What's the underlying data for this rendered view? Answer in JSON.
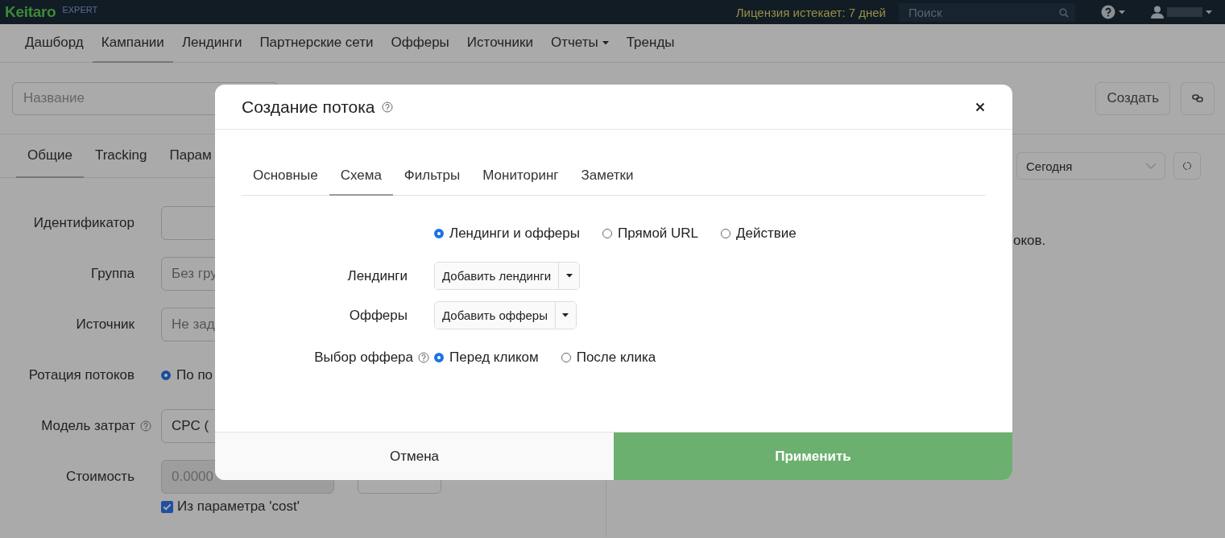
{
  "topbar": {
    "logo": "Keitaro",
    "edition": "EXPERT",
    "license": "Лицензия истекает: 7 дней",
    "search": {
      "placeholder": "Поиск"
    }
  },
  "nav": [
    {
      "label": "Дашборд",
      "selected": false,
      "dropdown": false
    },
    {
      "label": "Кампании",
      "selected": true,
      "dropdown": false
    },
    {
      "label": "Лендинги",
      "selected": false,
      "dropdown": false
    },
    {
      "label": "Партнерские сети",
      "selected": false,
      "dropdown": false
    },
    {
      "label": "Офферы",
      "selected": false,
      "dropdown": false
    },
    {
      "label": "Источники",
      "selected": false,
      "dropdown": false
    },
    {
      "label": "Отчеты",
      "selected": false,
      "dropdown": true
    },
    {
      "label": "Тренды",
      "selected": false,
      "dropdown": false
    }
  ],
  "toolbar": {
    "name_field": {
      "placeholder": "Название"
    },
    "create_button": "Создать"
  },
  "campaign_tabs": [
    {
      "label": "Общие",
      "selected": true
    },
    {
      "label": "Tracking",
      "selected": false
    },
    {
      "label": "Парам",
      "selected": false
    }
  ],
  "form": [
    {
      "label": "Идентификатор",
      "kind": "text"
    },
    {
      "label": "Группа",
      "kind": "text",
      "placeholder": "Без гру"
    },
    {
      "label": "Источник",
      "kind": "text",
      "placeholder": "Не зад"
    },
    {
      "label": "Ротация потоков",
      "kind": "radio",
      "option": "По по",
      "selected": true
    },
    {
      "label": "Модель затрат",
      "kind": "select",
      "help": true,
      "value": "CPC ("
    },
    {
      "label": "Стоимость",
      "kind": "cost",
      "value": "0.0000",
      "checkbox": {
        "label": "Из параметра 'cost'",
        "checked": true
      }
    }
  ],
  "right_panel": {
    "period": "Сегодня",
    "message": "оков."
  },
  "modal": {
    "title": "Создание потока",
    "tabs": [
      {
        "label": "Основные",
        "selected": false
      },
      {
        "label": "Схема",
        "selected": true
      },
      {
        "label": "Фильтры",
        "selected": false
      },
      {
        "label": "Мониторинг",
        "selected": false
      },
      {
        "label": "Заметки",
        "selected": false
      }
    ],
    "scheme_options": [
      {
        "label": "Лендинги и офферы",
        "selected": true
      },
      {
        "label": "Прямой URL",
        "selected": false
      },
      {
        "label": "Действие",
        "selected": false
      }
    ],
    "rows": [
      {
        "label": "Лендинги",
        "button": "Добавить лендинги"
      },
      {
        "label": "Офферы",
        "button": "Добавить офферы"
      }
    ],
    "offer_choice": {
      "label": "Выбор оффера",
      "options": [
        {
          "label": "Перед кликом",
          "selected": true
        },
        {
          "label": "После клика",
          "selected": false
        }
      ]
    },
    "cancel": "Отмена",
    "apply": "Применить"
  }
}
